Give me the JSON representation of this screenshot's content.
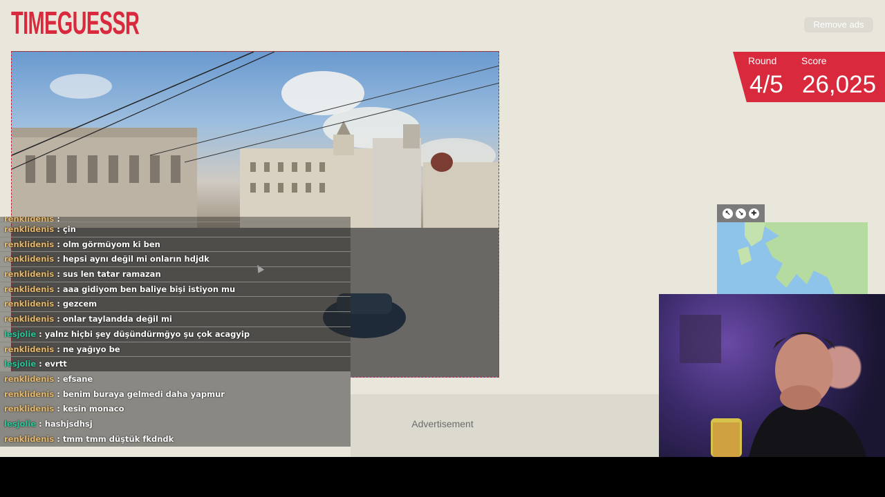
{
  "app": {
    "logo_text": "TIMEGUESSR",
    "remove_ads_label": "Remove ads",
    "brand_color": "#d9293d"
  },
  "game": {
    "round_label": "Round",
    "round_value": "4/5",
    "score_label": "Score",
    "score_value": "26,025"
  },
  "map": {
    "controls": [
      {
        "icon": "expand-up-left-icon"
      },
      {
        "icon": "expand-down-right-icon"
      },
      {
        "icon": "pin-icon"
      }
    ]
  },
  "advert": {
    "label": "Advertisement"
  },
  "chat": {
    "messages": [
      {
        "user": "renklidenis",
        "text": ""
      },
      {
        "user": "renklidenis",
        "text": "çin"
      },
      {
        "user": "renklidenis",
        "text": "olm görmüyom ki ben"
      },
      {
        "user": "renklidenis",
        "text": "hepsi aynı değil mi onların hdjdk"
      },
      {
        "user": "renklidenis",
        "text": "sus len tatar ramazan"
      },
      {
        "user": "renklidenis",
        "text": "aaa gidiyom ben baliye bişi istiyon mu"
      },
      {
        "user": "renklidenis",
        "text": "gezcem"
      },
      {
        "user": "renklidenis",
        "text": "onlar taylandda değil mi"
      },
      {
        "user": "lesjolie",
        "text": "yalnz hiçbi şey düşündürmğyo şu çok acagyip"
      },
      {
        "user": "renklidenis",
        "text": "ne yağıyo be"
      },
      {
        "user": "lesjolie",
        "text": "evrtt"
      },
      {
        "user": "renklidenis",
        "text": "efsane"
      },
      {
        "user": "renklidenis",
        "text": "benim buraya gelmedi daha yapmur"
      },
      {
        "user": "renklidenis",
        "text": "kesin monaco"
      },
      {
        "user": "lesjolie",
        "text": "hashjsdhsj"
      },
      {
        "user": "renklidenis",
        "text": "tmm tmm düştük fkdndk"
      }
    ]
  }
}
